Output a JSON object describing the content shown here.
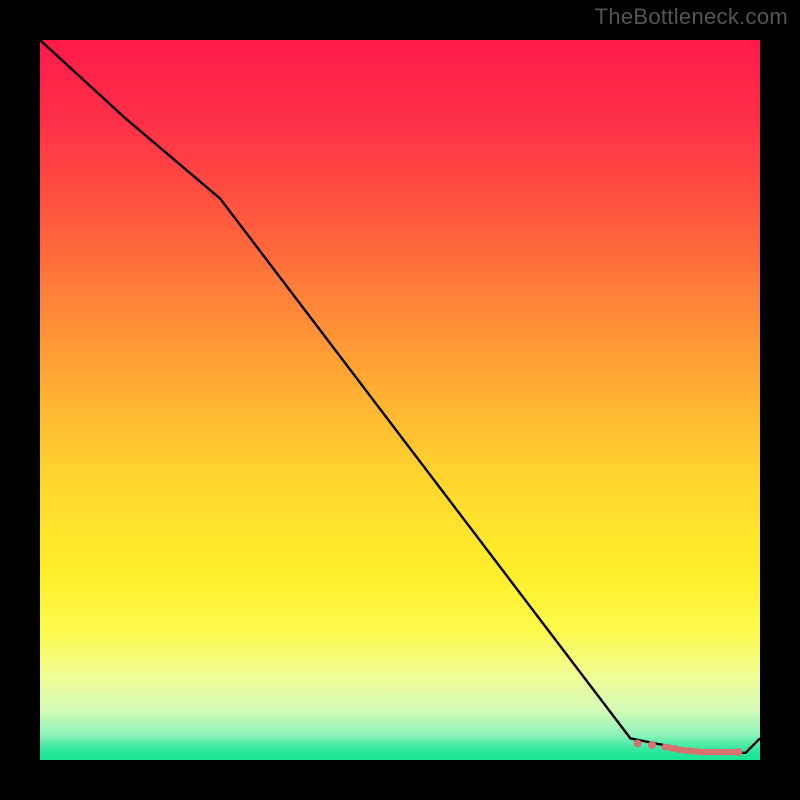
{
  "watermark": "TheBottleneck.com",
  "chart_data": {
    "type": "line",
    "title": "",
    "xlabel": "",
    "ylabel": "",
    "xlim": [
      0,
      100
    ],
    "ylim": [
      0,
      100
    ],
    "grid": false,
    "series": [
      {
        "name": "bottleneck-curve",
        "x": [
          0,
          12,
          25,
          82,
          92,
          98,
          100
        ],
        "values": [
          100,
          89,
          78,
          3,
          1,
          1,
          3
        ]
      }
    ],
    "markers": {
      "name": "optimal-points",
      "x": [
        83,
        85,
        87,
        88,
        89,
        90,
        91,
        92,
        93,
        94,
        95,
        96,
        97
      ],
      "values": [
        2.3,
        2.1,
        1.8,
        1.6,
        1.4,
        1.3,
        1.2,
        1.1,
        1.1,
        1.1,
        1.1,
        1.1,
        1.1
      ]
    },
    "gradient_stops": [
      {
        "offset": 0.0,
        "color": "#ff1a4a"
      },
      {
        "offset": 0.12,
        "color": "#ff3147"
      },
      {
        "offset": 0.25,
        "color": "#ff5a3e"
      },
      {
        "offset": 0.38,
        "color": "#ff8a38"
      },
      {
        "offset": 0.5,
        "color": "#ffb332"
      },
      {
        "offset": 0.62,
        "color": "#ffd82d"
      },
      {
        "offset": 0.74,
        "color": "#ffef2a"
      },
      {
        "offset": 0.82,
        "color": "#fcfa4a"
      },
      {
        "offset": 0.88,
        "color": "#f3fd92"
      },
      {
        "offset": 0.93,
        "color": "#d6fcb8"
      },
      {
        "offset": 0.965,
        "color": "#8cf3b8"
      },
      {
        "offset": 0.985,
        "color": "#34e8a0"
      },
      {
        "offset": 0.995,
        "color": "#1de595"
      },
      {
        "offset": 1.0,
        "color": "#18e693"
      }
    ],
    "line_color": "#000000",
    "marker_color": "#d9716f"
  }
}
